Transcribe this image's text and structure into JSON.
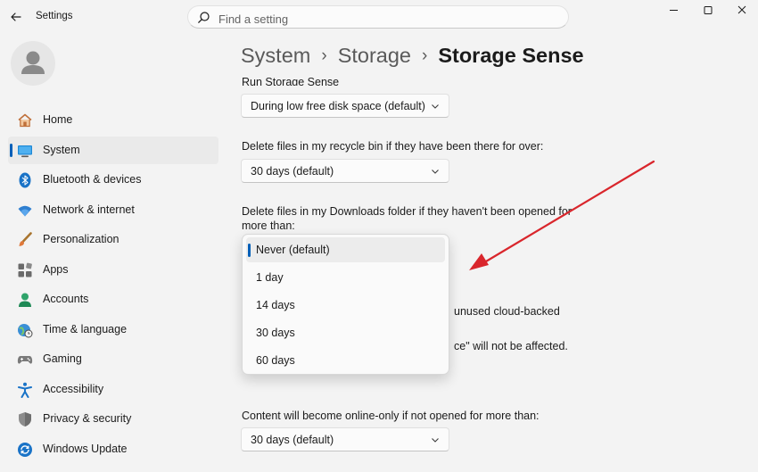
{
  "window": {
    "app_title": "Settings",
    "search_placeholder": "Find a setting"
  },
  "sidebar": {
    "items": [
      {
        "label": "Home",
        "icon": "home-icon",
        "selected": false
      },
      {
        "label": "System",
        "icon": "system-monitor-icon",
        "selected": true
      },
      {
        "label": "Bluetooth & devices",
        "icon": "bluetooth-icon",
        "selected": false
      },
      {
        "label": "Network & internet",
        "icon": "wifi-icon",
        "selected": false
      },
      {
        "label": "Personalization",
        "icon": "paintbrush-icon",
        "selected": false
      },
      {
        "label": "Apps",
        "icon": "apps-icon",
        "selected": false
      },
      {
        "label": "Accounts",
        "icon": "accounts-icon",
        "selected": false
      },
      {
        "label": "Time & language",
        "icon": "globe-clock-icon",
        "selected": false
      },
      {
        "label": "Gaming",
        "icon": "gamepad-icon",
        "selected": false
      },
      {
        "label": "Accessibility",
        "icon": "accessibility-icon",
        "selected": false
      },
      {
        "label": "Privacy & security",
        "icon": "shield-icon",
        "selected": false
      },
      {
        "label": "Windows Update",
        "icon": "windows-update-icon",
        "selected": false
      }
    ]
  },
  "breadcrumb": {
    "items": [
      "System",
      "Storage",
      "Storage Sense"
    ],
    "separator": "›"
  },
  "content": {
    "run_label": "Run Storage Sense",
    "run_value": "During low free disk space (default)",
    "recycle_label": "Delete files in my recycle bin if they have been there for over:",
    "recycle_value": "30 days (default)",
    "downloads_label_line1": "Delete files in my Downloads folder if they haven't been opened for",
    "downloads_label_line2": "more than:",
    "partial_line1": "unused cloud-backed",
    "partial_line2": "ce\" will not be affected.",
    "online_label": "Content will become online-only if not opened for more than:",
    "online_value": "30 days (default)"
  },
  "dropdown": {
    "options": [
      "Never (default)",
      "1 day",
      "14 days",
      "30 days",
      "60 days"
    ],
    "selected": "Never (default)"
  },
  "colors": {
    "accent": "#005fb8",
    "annotation_arrow": "#d9262c"
  }
}
